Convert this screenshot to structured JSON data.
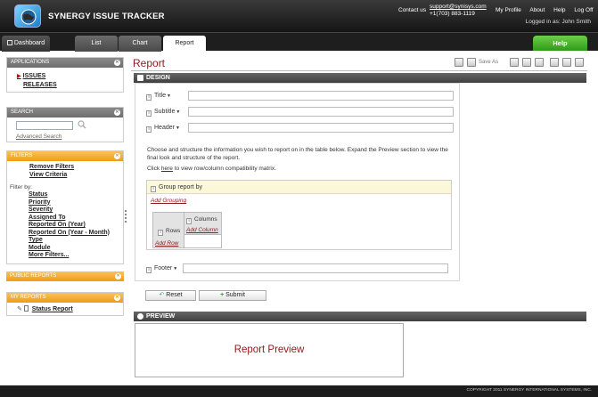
{
  "header": {
    "app_title": "SYNERGY ISSUE TRACKER",
    "contact_label": "Contact us",
    "contact_email": "support@synisys.com",
    "contact_phone": "+1(703) 883-1119",
    "links": [
      "My Profile",
      "About",
      "Help",
      "Log Off"
    ],
    "logged_in_label": "Logged in as:",
    "logged_in_user": "John Smith"
  },
  "tabs": {
    "dashboard": "Dashboard",
    "list": "List",
    "chart": "Chart",
    "report": "Report",
    "help": "Help"
  },
  "sidebar": {
    "applications": {
      "title": "APPLICATIONS",
      "items": [
        "ISSUES",
        "RELEASES"
      ]
    },
    "search": {
      "title": "SEARCH",
      "input_value": "",
      "advanced_link": "Advanced Search"
    },
    "filters": {
      "title": "FILTERS",
      "remove": "Remove Filters",
      "view_criteria": "View Criteria",
      "filter_by_label": "Filter by:",
      "fields": [
        "Status",
        "Priority",
        "Severity",
        "Assigned To",
        "Reported On (Year)",
        "Reported On (Year - Month)",
        "Type",
        "Module",
        "More Filters..."
      ]
    },
    "public_reports": {
      "title": "PUBLIC REPORTS"
    },
    "my_reports": {
      "title": "MY REPORTS",
      "items": [
        "Status Report"
      ]
    }
  },
  "main": {
    "page_title": "Report",
    "toolbar": {
      "save_as": "Save As"
    },
    "design": {
      "section_title": "DESIGN",
      "fields": {
        "title_label": "Title",
        "title_value": "",
        "subtitle_label": "Subtitle",
        "subtitle_value": "",
        "header_label": "Header",
        "header_value": "",
        "footer_label": "Footer",
        "footer_value": ""
      },
      "description": "Choose and structure the information you wish to report on in the table below. Expand the Preview section to view the final look and structure of the report.",
      "click_prefix": "Click",
      "click_link": "here",
      "click_suffix": "to view row/column compatibility matrix.",
      "group_label": "Group report by",
      "add_grouping": "Add Grouping",
      "columns_label": "Columns",
      "add_column": "Add Column",
      "rows_label": "Rows",
      "add_row": "Add Row",
      "reset": "Reset",
      "submit": "Submit"
    },
    "preview": {
      "section_title": "PREVIEW",
      "placeholder": "Report Preview"
    }
  },
  "footer": {
    "copyright": "COPYRIGHT 2011 SYNERGY INTERNATIONAL SYSTEMS, INC."
  }
}
